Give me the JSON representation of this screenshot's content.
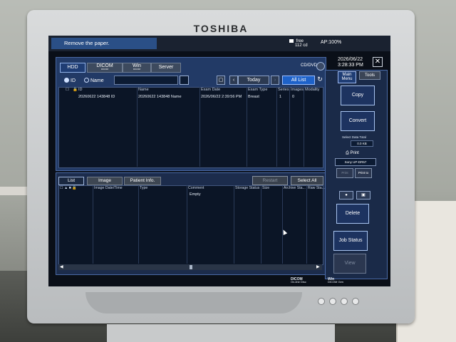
{
  "device": {
    "brand": "TOSHIBA"
  },
  "status_bar": {
    "message": "Remove the paper.",
    "free_label": "free",
    "free_value": "112 cd",
    "ap": "AP:100%",
    "date": "2026/06/22",
    "time": "3:28:33 PM"
  },
  "source_tabs": [
    {
      "label": "HDD",
      "active": true
    },
    {
      "label": "DICOM",
      "sub": "DICOM",
      "active": false
    },
    {
      "label": "Win",
      "sub": "DICOM",
      "active": false
    },
    {
      "label": "Server",
      "active": false
    }
  ],
  "cddvd": "CD/DVD",
  "search": {
    "id_option": "ID",
    "name_option": "Name",
    "selected": "ID",
    "query": "",
    "today": "Today",
    "all_list": "All List"
  },
  "study_table": {
    "columns": [
      "ID",
      "Name",
      "Exam Date",
      "Exam Type",
      "Series",
      "Images",
      "Modality"
    ],
    "rows": [
      {
        "id": "20260622 143848 ID",
        "name": "20260622 143848 Name",
        "exam_date": "2026/06/22 2:39:56 PM",
        "exam_type": "Breast",
        "series": "1",
        "images": "0",
        "modality": ""
      }
    ]
  },
  "lower_tabs": [
    {
      "label": "List",
      "active": true
    },
    {
      "label": "Image",
      "active": false
    },
    {
      "label": "Patient Info.",
      "active": false
    }
  ],
  "lower_actions": {
    "restart": "Restart",
    "select_all": "Select All"
  },
  "image_table": {
    "columns": [
      "Image Date/Time",
      "Type",
      "Comment",
      "Storage Status",
      "Size",
      "Archive Sta...",
      "Raw Sta..."
    ],
    "empty_text": "Empty"
  },
  "menu": {
    "tabs": [
      {
        "label": "Main Menu",
        "active": true
      },
      {
        "label": "Tools",
        "active": false
      }
    ],
    "copy": "Copy",
    "convert": "Convert",
    "select_data_label": "Select Data Total",
    "select_data_value": "0.0 KB",
    "print_label": "Print",
    "printer": "Sony UP-DR57",
    "print_btn": "Print",
    "print_to_btn": "Print to",
    "delete": "Delete",
    "job_status": "Job Status",
    "view": "View"
  },
  "bottom_indicators": [
    {
      "title": "DICOM",
      "line1": "On-line",
      "line2": "Disc"
    },
    {
      "title": "Win",
      "line1": "DICOM",
      "line2": "Gen"
    }
  ],
  "colors": {
    "screen_bg": "#0a0f18",
    "panel_blue": "#223a66",
    "accent_blue": "#1e62c9",
    "bezel": "#cfd1d3"
  }
}
